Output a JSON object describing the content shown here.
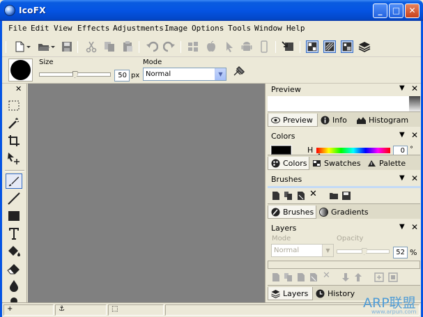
{
  "window": {
    "title": "IcoFX",
    "minimize": "_",
    "maximize": "□",
    "close": "✕"
  },
  "menu": [
    "File",
    "Edit",
    "View",
    "Effects",
    "Adjustments",
    "Image",
    "Options",
    "Tools",
    "Window",
    "Help"
  ],
  "options_bar": {
    "size_label": "Size",
    "size_value": "50",
    "size_unit": "px",
    "size_fraction": 0.5,
    "mode_label": "Mode",
    "mode_value": "Normal"
  },
  "tool_panel": {
    "close_glyph": "✕"
  },
  "panels": {
    "preview": {
      "title": "Preview",
      "tabs": [
        "Preview",
        "Info",
        "Histogram"
      ],
      "selected_tab": 0
    },
    "colors": {
      "title": "Colors",
      "hue_label": "H",
      "hue_value": "0",
      "hue_unit": "°",
      "tabs": [
        "Colors",
        "Swatches",
        "Palette"
      ],
      "selected_tab": 0,
      "current_color": "#000000"
    },
    "brushes": {
      "title": "Brushes",
      "tabs": [
        "Brushes",
        "Gradients"
      ],
      "selected_tab": 0
    },
    "layers": {
      "title": "Layers",
      "mode_label": "Mode",
      "mode_value": "Normal",
      "opacity_label": "Opacity",
      "opacity_value": "52",
      "opacity_unit": "%",
      "opacity_fraction": 0.52,
      "tabs": [
        "Layers",
        "History"
      ],
      "selected_tab": 0
    },
    "menu_glyph": "▼",
    "close_glyph": "✕"
  },
  "status": {
    "cells": [
      "+",
      "⚓",
      "⬚"
    ]
  },
  "watermark": {
    "text": "ARP联盟",
    "url": "www.arpun.com"
  },
  "colors": {
    "canvas": "#808080",
    "accent": "#316ac5",
    "titlebar": "#0554e3"
  }
}
